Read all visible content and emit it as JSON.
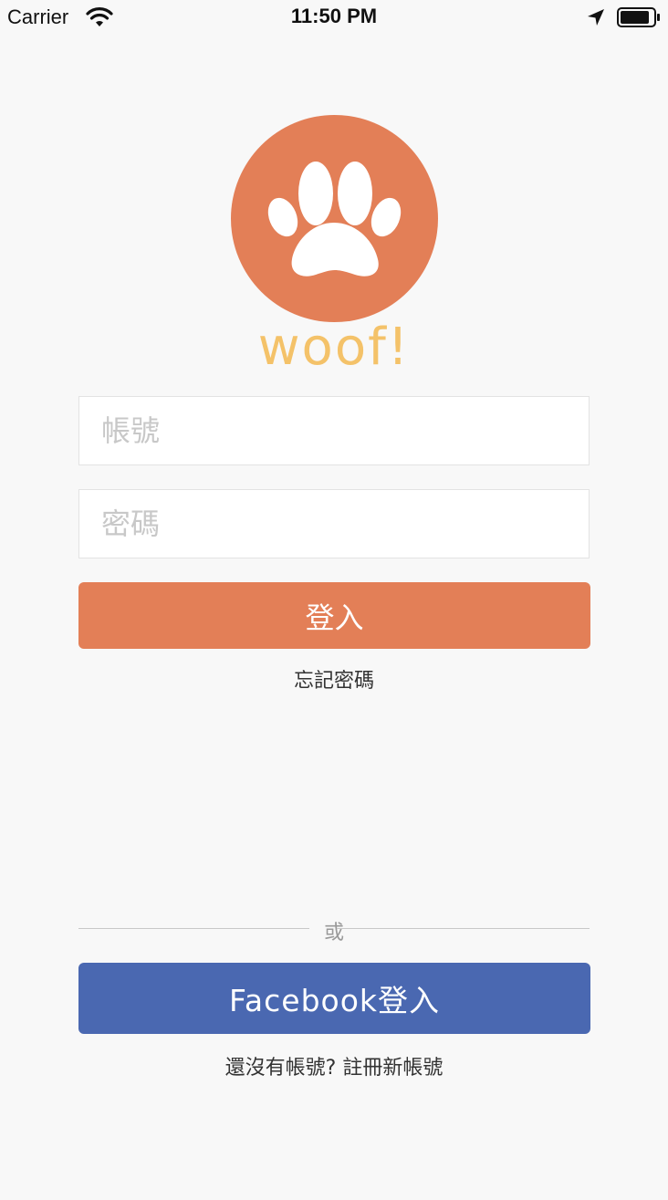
{
  "status_bar": {
    "carrier": "Carrier",
    "time": "11:50 PM",
    "icons": [
      "wifi-icon",
      "location-arrow-icon",
      "battery-icon"
    ]
  },
  "logo": {
    "text": "woof!",
    "icon": "paw-icon",
    "circle_color": "#e37f57",
    "text_color": "#f4c269"
  },
  "form": {
    "account_placeholder": "帳號",
    "account_value": "",
    "password_placeholder": "密碼",
    "password_value": "",
    "login_label": "登入",
    "forgot_password": "忘記密碼"
  },
  "divider": {
    "label": "或"
  },
  "facebook": {
    "label": "Facebook登入",
    "color": "#4a68b1"
  },
  "register": {
    "text": "還沒有帳號? 註冊新帳號"
  },
  "colors": {
    "accent": "#e37f57",
    "background": "#f8f8f8",
    "facebook": "#4a68b1"
  }
}
